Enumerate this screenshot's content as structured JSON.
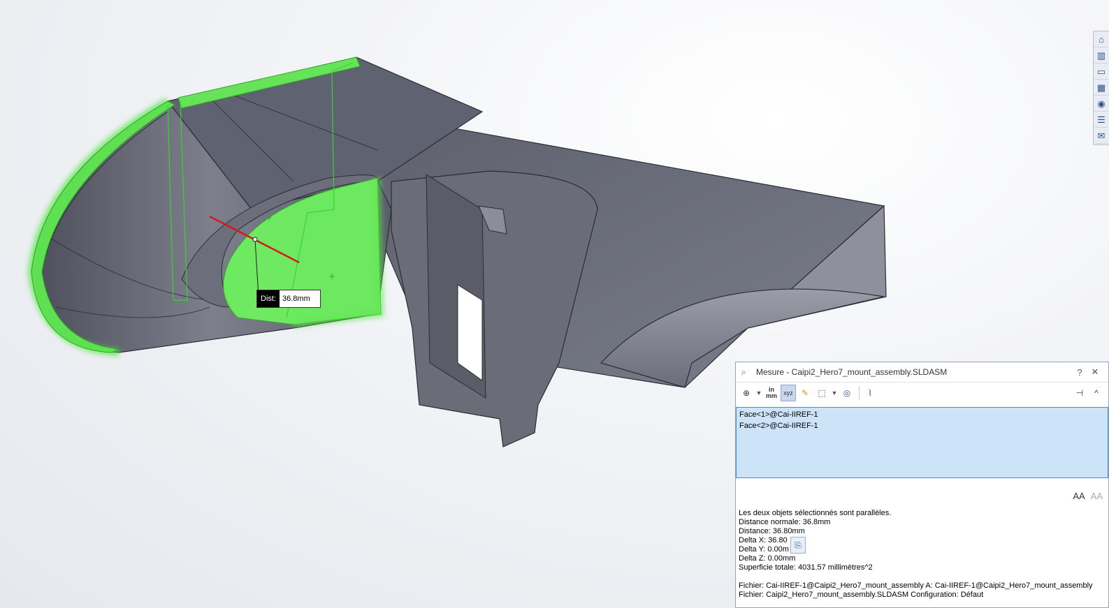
{
  "viewport": {
    "dimension": {
      "label": "Dist:",
      "value": "36.8mm"
    }
  },
  "taskpane": {
    "tabs": [
      {
        "name": "home",
        "glyph": "⌂"
      },
      {
        "name": "design-library",
        "glyph": "▥"
      },
      {
        "name": "file-explorer",
        "glyph": "▭"
      },
      {
        "name": "view-palette",
        "glyph": "▦"
      },
      {
        "name": "appearances",
        "glyph": "◉"
      },
      {
        "name": "custom-properties",
        "glyph": "☰"
      },
      {
        "name": "forum",
        "glyph": "✉"
      }
    ]
  },
  "measure": {
    "title": "Mesure - Caipi2_Hero7_mount_assembly.SLDASM",
    "help": "?",
    "close": "✕",
    "toolbar": {
      "arc_circle": "⊕",
      "units_in": "in",
      "units_mm": "mm",
      "xyz": "xyz",
      "point_to_point": "✎",
      "projection": "⬚",
      "sensor": "◎",
      "history": "⌇",
      "pin": "⊣",
      "collapse": "^"
    },
    "selections": [
      "Face<1>@Cai-IIREF-1",
      "Face<2>@Cai-IIREF-1"
    ],
    "font_increase": "AA",
    "font_decrease": "AA",
    "results": [
      "Les deux objets sélectionnés sont parallèles.",
      "Distance normale: 36.8mm",
      "Distance: 36.80mm",
      "Delta X: 36.80",
      "Delta Y: 0.00m",
      "Delta Z: 0.00mm",
      "Superficie totale: 4031.57 millimètres^2"
    ],
    "files": [
      "Fichier: Cai-IIREF-1@Caipi2_Hero7_mount_assembly A: Cai-IIREF-1@Caipi2_Hero7_mount_assembly",
      "Fichier: Caipi2_Hero7_mount_assembly.SLDASM Configuration: Défaut"
    ]
  }
}
